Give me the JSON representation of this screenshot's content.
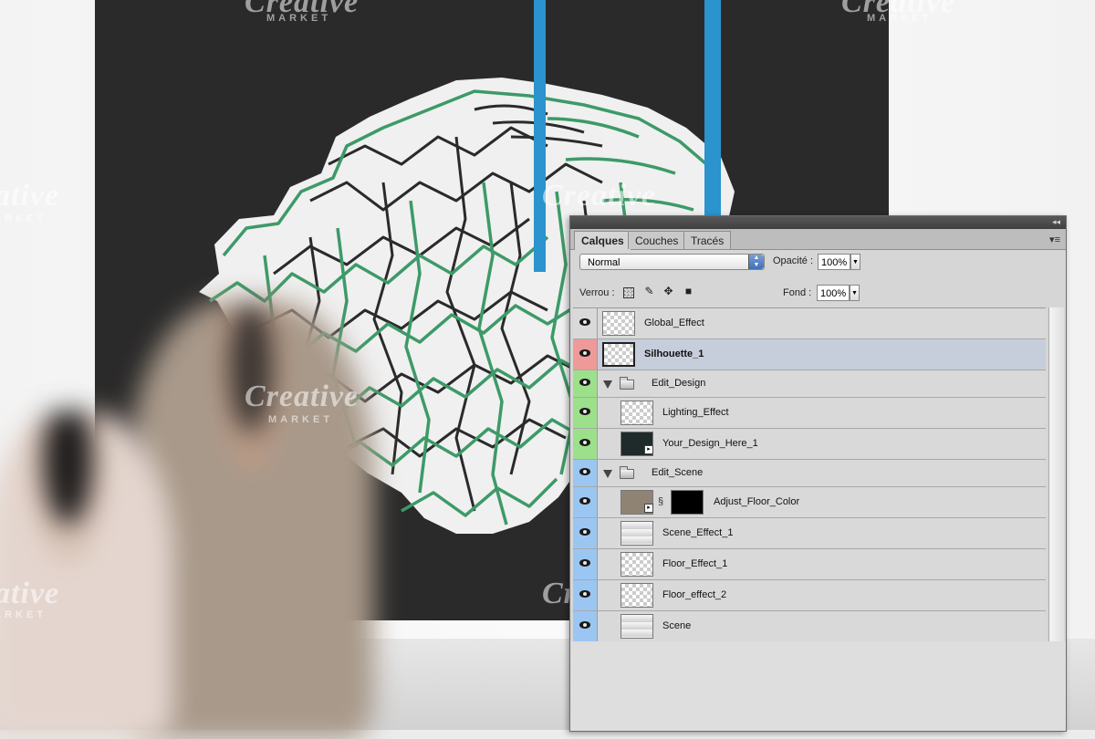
{
  "watermark": {
    "brand": "Creative",
    "sub": "MARKET"
  },
  "colors": {
    "poster": "#2b2a2a",
    "brain_green": "#3d9a68",
    "strap_blue": "#2b93cd",
    "eye_red": "#ee9a99",
    "eye_green": "#9de08c",
    "eye_blue": "#9cc6f2",
    "selected": "#c6cedc"
  },
  "panel": {
    "collapse_icon": "◂◂",
    "menu_icon": "▾≡",
    "tabs": [
      {
        "label": "Calques",
        "active": true
      },
      {
        "label": "Couches",
        "active": false
      },
      {
        "label": "Tracés",
        "active": false
      }
    ],
    "blend_mode": "Normal",
    "opacity_label": "Opacité :",
    "opacity_value": "100%",
    "lock_label": "Verrou :",
    "fill_label": "Fond :",
    "fill_value": "100%",
    "lock_icons": [
      "transparency-lock-icon",
      "brush-lock-icon",
      "move-lock-icon",
      "padlock-icon"
    ],
    "layers": [
      {
        "name": "Global_Effect",
        "eye_color": "none",
        "thumb": "checker",
        "indent": 0,
        "type": "layer"
      },
      {
        "name": "Silhouette_1",
        "eye_color": "red",
        "thumb": "checker",
        "indent": 0,
        "type": "layer",
        "selected": true
      },
      {
        "name": "Edit_Design",
        "eye_color": "green",
        "indent": 0,
        "type": "group"
      },
      {
        "name": "Lighting_Effect",
        "eye_color": "green",
        "thumb": "checker",
        "indent": 1,
        "type": "layer"
      },
      {
        "name": "Your_Design_Here_1",
        "eye_color": "green",
        "thumb": "dark",
        "indent": 1,
        "type": "smart"
      },
      {
        "name": "Edit_Scene",
        "eye_color": "blue",
        "indent": 0,
        "type": "group"
      },
      {
        "name": "Adjust_Floor_Color",
        "eye_color": "blue",
        "thumb": "brown",
        "indent": 1,
        "type": "mask"
      },
      {
        "name": "Scene_Effect_1",
        "eye_color": "blue",
        "thumb": "grad",
        "indent": 1,
        "type": "layer"
      },
      {
        "name": "Floor_Effect_1",
        "eye_color": "blue",
        "thumb": "checker",
        "indent": 1,
        "type": "layer"
      },
      {
        "name": "Floor_effect_2",
        "eye_color": "blue",
        "thumb": "checker",
        "indent": 1,
        "type": "layer"
      },
      {
        "name": "Scene",
        "eye_color": "blue",
        "thumb": "grad",
        "indent": 1,
        "type": "layer"
      }
    ]
  }
}
